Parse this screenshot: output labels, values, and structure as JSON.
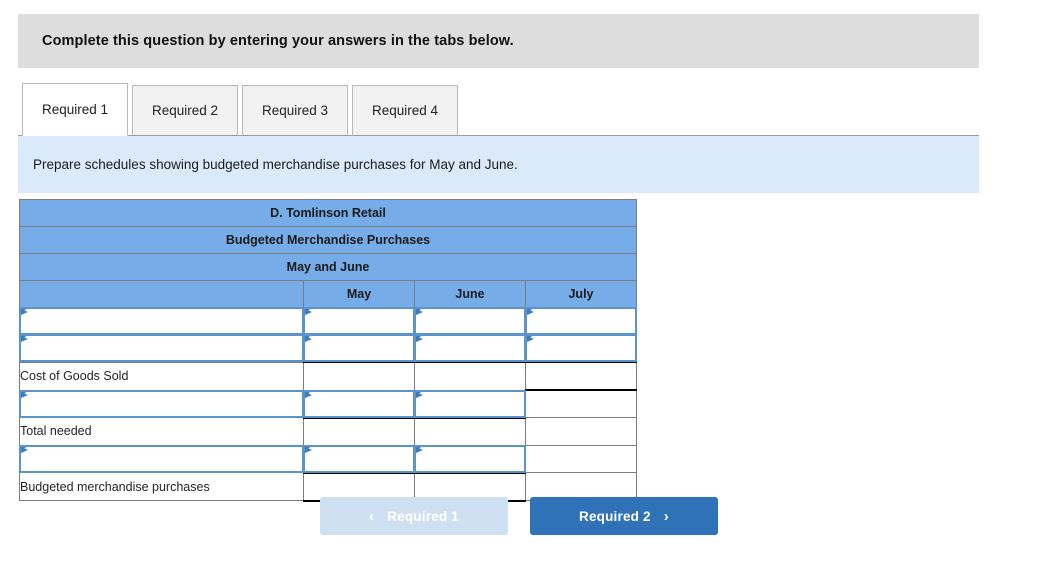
{
  "banner": {
    "text": "Complete this question by entering your answers in the tabs below."
  },
  "tabs": [
    {
      "label": "Required 1",
      "active": true
    },
    {
      "label": "Required 2",
      "active": false
    },
    {
      "label": "Required 3",
      "active": false
    },
    {
      "label": "Required 4",
      "active": false
    }
  ],
  "instruction": {
    "text": "Prepare schedules showing budgeted merchandise purchases for May and June."
  },
  "worksheet": {
    "title_line_1": "D. Tomlinson Retail",
    "title_line_2": "Budgeted Merchandise Purchases",
    "title_line_3": "May and June",
    "column_headers": [
      "",
      "May",
      "June",
      "July"
    ],
    "rows": [
      {
        "label": "",
        "type": "input",
        "cells": [
          "input",
          "input",
          "input"
        ]
      },
      {
        "label": "",
        "type": "input",
        "cells": [
          "input",
          "input",
          "input"
        ]
      },
      {
        "label": "Cost of Goods Sold",
        "type": "label",
        "cells": [
          "",
          "",
          ""
        ]
      },
      {
        "label": "",
        "type": "input",
        "cells": [
          "input",
          "input",
          ""
        ]
      },
      {
        "label": "Total needed",
        "type": "label",
        "cells": [
          "",
          "",
          ""
        ]
      },
      {
        "label": "",
        "type": "input",
        "cells": [
          "input",
          "input",
          ""
        ]
      },
      {
        "label": "Budgeted merchandise purchases",
        "type": "label",
        "cells": [
          "",
          "",
          ""
        ]
      }
    ]
  },
  "navigation": {
    "prev_label": "Required 1",
    "prev_chevron": "chevron-left-icon",
    "prev_glyph": "‹",
    "next_label": "Required 2",
    "next_chevron": "chevron-right-icon",
    "next_glyph": "›"
  },
  "colors": {
    "banner_gray": "#dddddd",
    "instruction_blue": "#dbeafa",
    "sheet_header_blue": "#76ade8",
    "input_border_blue": "#5b93cd",
    "button_active_blue": "#2f72b8",
    "button_disabled_blue": "#cfe0f2"
  }
}
